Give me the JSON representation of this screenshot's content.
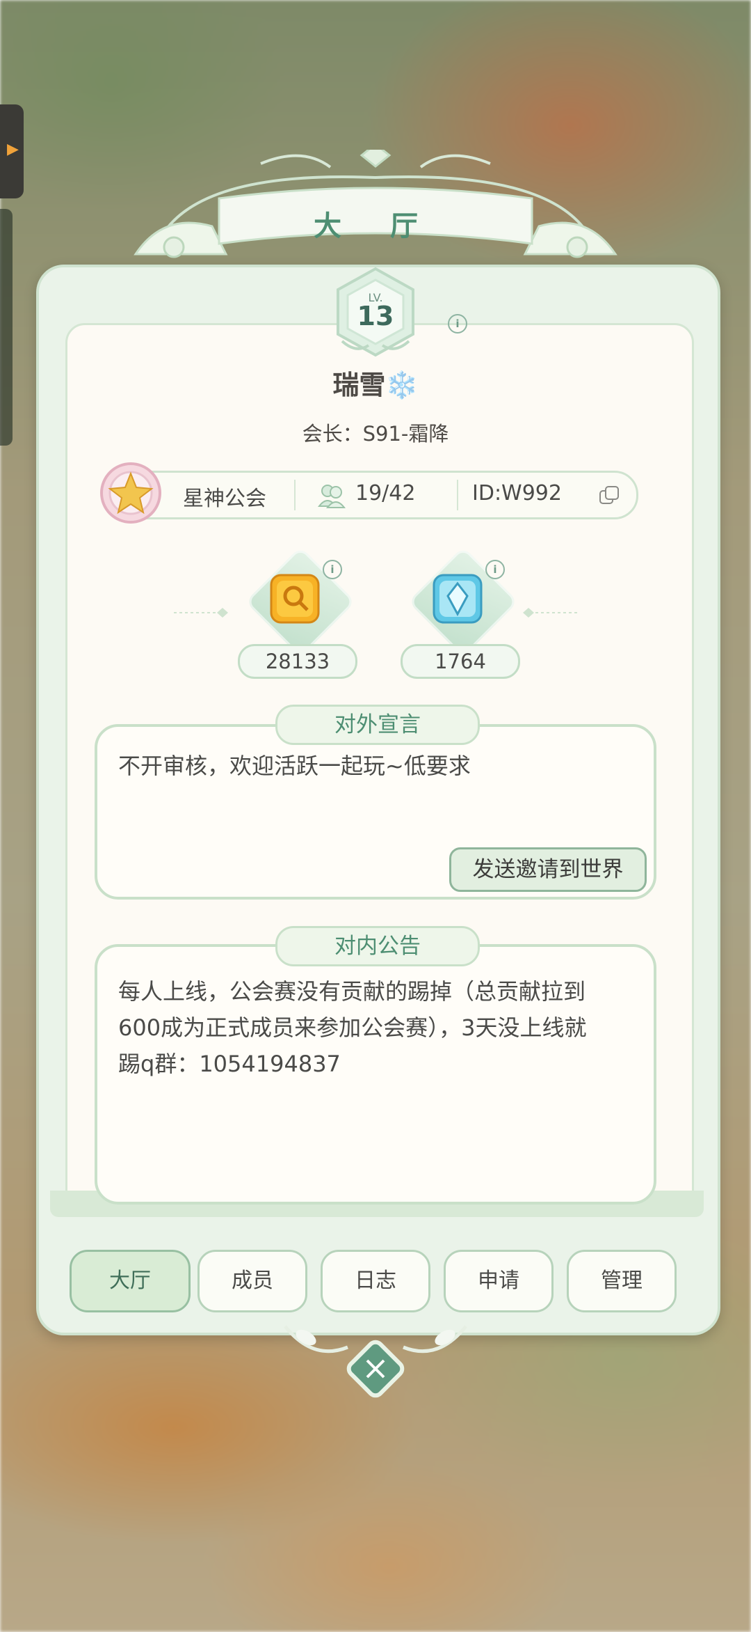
{
  "hall": {
    "title": "大 厅",
    "level_prefix": "LV.",
    "level": "13",
    "guild_name": "瑞雪",
    "guild_name_emoji": "❄️",
    "leader_line": "会长：S91-霜降"
  },
  "info_bar": {
    "guild_type": "星神公会",
    "members": "19/42",
    "guild_id": "ID:W992"
  },
  "resources": [
    {
      "value": "28133",
      "icon": "gold-key-coin-icon"
    },
    {
      "value": "1764",
      "icon": "blue-crystal-icon"
    }
  ],
  "external_declaration": {
    "title": "对外宣言",
    "text": "不开审核，欢迎活跃一起玩~低要求",
    "invite_button": "发送邀请到世界"
  },
  "internal_notice": {
    "title": "对内公告",
    "lines": [
      "每人上线，公会赛没有贡献的踢掉（总贡献拉到",
      "600成为正式成员来参加公会赛），3天没上线就",
      "踢q群：1054194837"
    ]
  },
  "tabs": [
    "大厅",
    "成员",
    "日志",
    "申请",
    "管理"
  ],
  "colors": {
    "accent_green": "#4d8e72",
    "panel_border": "#c9e0c9",
    "active_tab": "#d9ecd5"
  }
}
